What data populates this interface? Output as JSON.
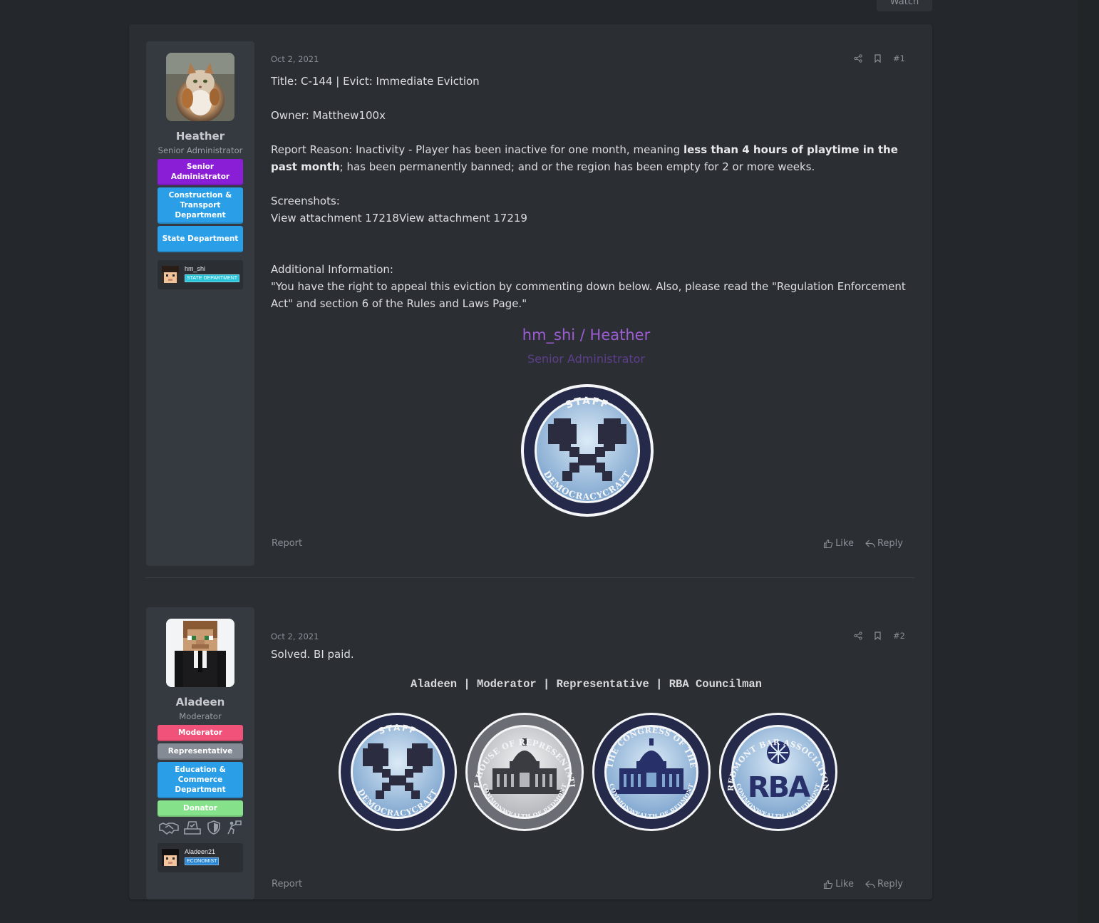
{
  "header": {
    "watch_label": "Watch"
  },
  "posts": [
    {
      "date": "Oct 2, 2021",
      "number": "#1",
      "author": {
        "name": "Heather",
        "title": "Senior Administrator",
        "banners": [
          {
            "label": "Senior Administrator",
            "color": "#8a1ed6"
          },
          {
            "label": "Construction & Transport Department",
            "color": "#2a9ee6"
          },
          {
            "label": "State Department",
            "color": "#2a9ee6"
          }
        ],
        "mc_name": "hm_shi",
        "mc_badge": "STATE DEPARTMENT"
      },
      "lines": {
        "title": "Title: C-144 | Evict: Immediate Eviction",
        "owner": "Owner: Matthew100x",
        "reason_prefix": "Report Reason: Inactivity - Player has been inactive for one month, meaning ",
        "reason_bold": "less than 4 hours of playtime in the past month",
        "reason_suffix": "; has been permanently banned; and or the region has been empty for 2 or more weeks.",
        "screenshots_label": "Screenshots:",
        "attachments": "View attachment 17218View attachment 17219",
        "additional_label": "Additional Information:",
        "additional_text": "\"You have the right to appeal this eviction by commenting down below. Also, please read the \"Regulation Enforcement Act\" and section 6 of the Rules and Laws Page.\""
      },
      "signature": {
        "name": "hm_shi / Heather",
        "role": "Senior Administrator",
        "seals": [
          "STAFF · DEMOCRACYCRAFT"
        ]
      },
      "report_label": "Report",
      "like_label": "Like",
      "reply_label": "Reply"
    },
    {
      "date": "Oct 2, 2021",
      "number": "#2",
      "author": {
        "name": "Aladeen",
        "title": "Moderator",
        "banners": [
          {
            "label": "Moderator",
            "color": "#f0527a"
          },
          {
            "label": "Representative",
            "color": "#848b95"
          },
          {
            "label": "Education & Commerce Department",
            "color": "#2a9ee6"
          },
          {
            "label": "Donator",
            "color": "#86e28a"
          }
        ],
        "trophies": [
          "handshake-icon",
          "ballot-box-icon",
          "shield-icon",
          "protester-icon"
        ],
        "mc_name": "Aladeen21",
        "mc_badge": "ECONOMIST"
      },
      "lines": {
        "body": "Solved. BI paid."
      },
      "signature": {
        "line": "Aladeen | Moderator | Representative | RBA Councilman",
        "seals": [
          "STAFF · DEMOCRACYCRAFT",
          "SEAL OF THE HOUSE OF REPRESENTATIVES OF THE · COMMONWEALTH OF REDMONT",
          "THE CONGRESS OF THE · COMMONWEALTH OF REDMONT",
          "REDMONT BAR ASSOCIATION · RBA · COMMONWEALTH OF REDMONT"
        ]
      },
      "report_label": "Report",
      "like_label": "Like",
      "reply_label": "Reply"
    }
  ],
  "colors": {
    "background": "#24272b",
    "card": "#2b2f34",
    "user_cell": "#353a41",
    "signature_purple": "#9d5cd3",
    "seal_navy": "#252a4a"
  }
}
